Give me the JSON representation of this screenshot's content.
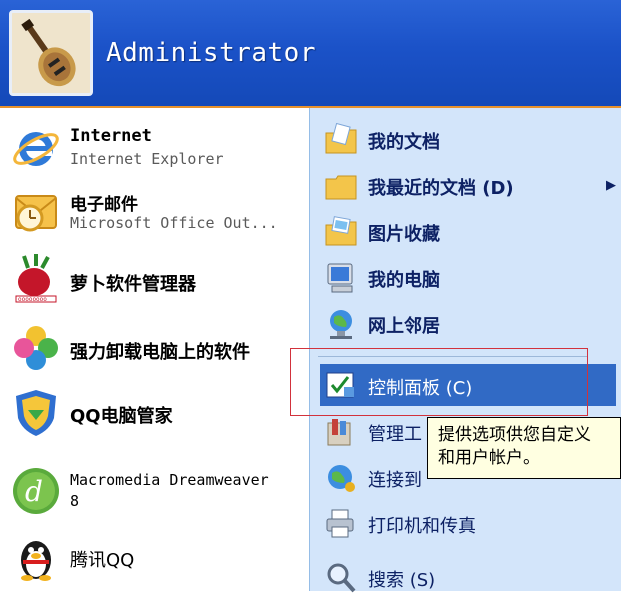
{
  "user": {
    "name": "Administrator"
  },
  "left_items": [
    {
      "title": "Internet",
      "subtitle": "Internet Explorer"
    },
    {
      "title": "电子邮件",
      "subtitle": "Microsoft Office Out..."
    },
    {
      "title": "萝卜软件管理器"
    },
    {
      "title": "强力卸载电脑上的软件"
    },
    {
      "title": "QQ电脑管家"
    },
    {
      "title": "Macromedia Dreamweaver",
      "title2": "8"
    },
    {
      "title": "腾讯QQ"
    }
  ],
  "right_items": [
    {
      "label": "我的文档"
    },
    {
      "label": "我最近的文档 (D)",
      "arrow": "▶"
    },
    {
      "label": "图片收藏"
    },
    {
      "label": "我的电脑"
    },
    {
      "label": "网上邻居"
    },
    {
      "label": "控制面板 (C)"
    },
    {
      "label": "管理工"
    },
    {
      "label": "连接到"
    },
    {
      "label": "打印机和传真"
    },
    {
      "label": "搜索 (S)"
    }
  ],
  "tooltip": {
    "line1": "提供选项供您自定义",
    "line2": "和用户帐户。"
  },
  "colors": {
    "header": "#1b52c8",
    "highlight": "#316ac5",
    "right_pane": "#d3e5fa",
    "accent_line": "#e8922c",
    "annotation": "#d2323c"
  }
}
